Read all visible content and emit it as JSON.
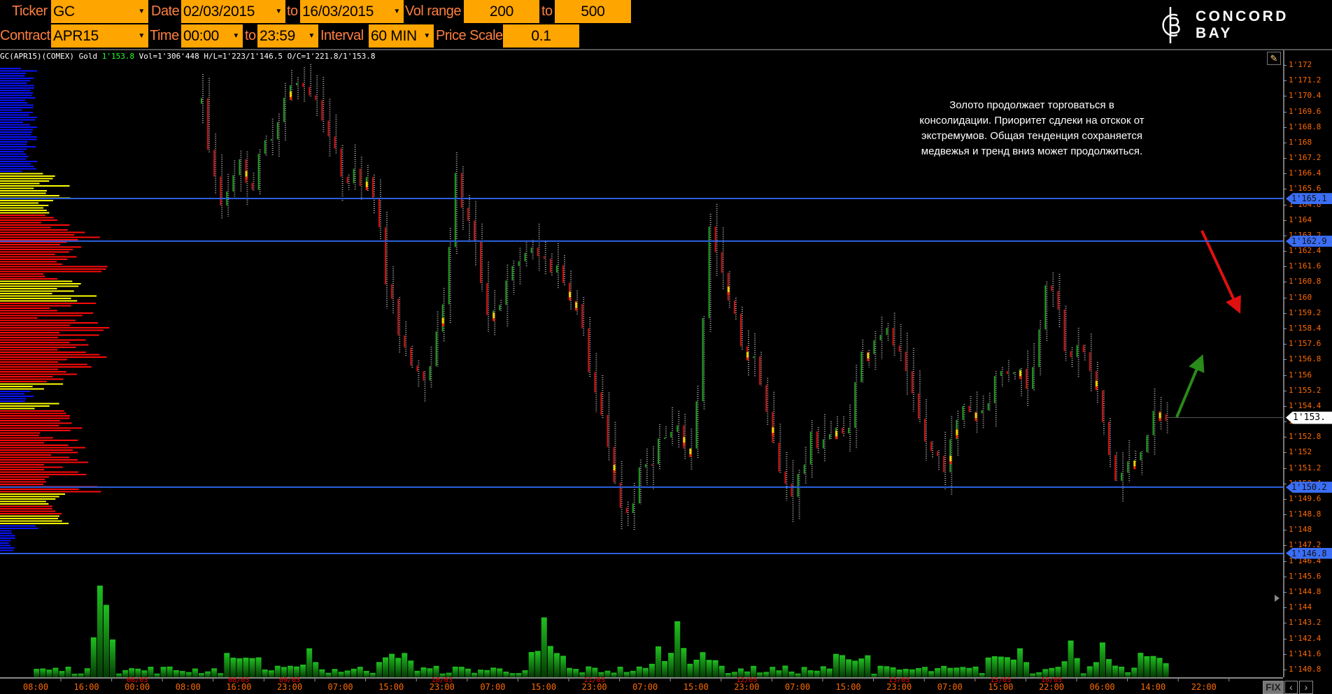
{
  "toolbar": {
    "ticker_label": "Ticker",
    "ticker_value": "GC",
    "date_label": "Date",
    "date_from": "02/03/2015",
    "date_to_label": "to",
    "date_to": "16/03/2015",
    "vol_range_label": "Vol range",
    "vol_from": "200",
    "vol_to_label": "to",
    "vol_to": "500",
    "contract_label": "Contract",
    "contract_value": "APR15",
    "time_label": "Time",
    "time_from": "00:00",
    "time_to_label": "to",
    "time_to": "23:59",
    "interval_label": "Interval",
    "interval_value": "60 MIN",
    "price_scale_label": "Price Scale",
    "price_scale_value": "0.1"
  },
  "logo": {
    "text": "CONCORD BAY"
  },
  "info": {
    "prefix": "GC(APR15)(COMEX) Gold ",
    "last": "1'153.8",
    "stats": " Vol=1'306'448 H/L=1'223/1'146.5 O/C=1'221.8/1'153.8"
  },
  "annotation": {
    "lines": [
      "Золото продолжает торговаться в",
      "консолидации. Приоритет сдлеки на отскок от",
      "экстремумов.  Общая тенденция сохраняется",
      "медвежья и тренд вниз может продолжиться."
    ]
  },
  "levels": [
    {
      "price": 1165.1,
      "label": "1'165.1"
    },
    {
      "price": 1162.9,
      "label": "1'162.9"
    },
    {
      "price": 1150.2,
      "label": "1'150.2"
    },
    {
      "price": 1146.8,
      "label": "1'146.8"
    }
  ],
  "current": {
    "price": 1153.8,
    "label": "1'153."
  },
  "colors": {
    "toolbar_bg": "#ffa500",
    "label": "#ff7f3f",
    "axis_text": "#ff6a00",
    "level": "#2b5fdc",
    "up": "#1f9e1f",
    "down": "#d01010",
    "arrow_down": "#e01010",
    "arrow_up": "#2a8a1a"
  },
  "chart_data": {
    "type": "candlestick",
    "price_range": [
      1140.4,
      1172.6
    ],
    "price_ticks": [
      "1'172",
      "1'171.2",
      "1'170.4",
      "1'169.6",
      "1'168.8",
      "1'168",
      "1'167.2",
      "1'166.4",
      "1'165.6",
      "1'164.8",
      "1'164",
      "1'163.2",
      "1'162.4",
      "1'161.6",
      "1'160.8",
      "1'160",
      "1'159.2",
      "1'158.4",
      "1'157.6",
      "1'156.8",
      "1'156",
      "1'155.2",
      "1'154.4",
      "1'153.6",
      "1'152.8",
      "1'152",
      "1'151.2",
      "1'150.4",
      "1'149.6",
      "1'148.8",
      "1'148",
      "1'147.2",
      "1'146.4",
      "1'145.6",
      "1'144.8",
      "1'144",
      "1'143.2",
      "1'142.4",
      "1'141.6",
      "1'140.8"
    ],
    "time_labels": [
      {
        "t": "08:00"
      },
      {
        "t": "16:00"
      },
      {
        "t": "00:00",
        "d": "06/03"
      },
      {
        "t": "08:00"
      },
      {
        "t": "16:00",
        "d": "08/03"
      },
      {
        "t": "23:00",
        "d": "09/03"
      },
      {
        "t": "07:00"
      },
      {
        "t": "15:00"
      },
      {
        "t": "23:00",
        "d": "10/03"
      },
      {
        "t": "07:00"
      },
      {
        "t": "15:00"
      },
      {
        "t": "23:00",
        "d": "11/03"
      },
      {
        "t": "07:00"
      },
      {
        "t": "15:00"
      },
      {
        "t": "23:00",
        "d": "12/03"
      },
      {
        "t": "07:00"
      },
      {
        "t": "15:00"
      },
      {
        "t": "23:00",
        "d": "13/03"
      },
      {
        "t": "07:00"
      },
      {
        "t": "15:00",
        "d": "15/03"
      },
      {
        "t": "22:00",
        "d": "16/03"
      },
      {
        "t": "06:00"
      },
      {
        "t": "14:00"
      },
      {
        "t": "22:00"
      }
    ],
    "close_path": [
      1170,
      1164.5,
      1167,
      1166,
      1168.5,
      1170.5,
      1171.2,
      1170,
      1166.8,
      1166.2,
      1166.5,
      1160,
      1157.5,
      1156,
      1158,
      1166,
      1163,
      1159,
      1160.5,
      1162.5,
      1162,
      1161.5,
      1160,
      1156,
      1152,
      1148.5,
      1151,
      1152.5,
      1153,
      1152,
      1163.5,
      1160,
      1157.5,
      1156,
      1151,
      1150,
      1152.5,
      1153,
      1152.8,
      1157,
      1158.5,
      1157.5,
      1154.5,
      1152,
      1151.5,
      1154.5,
      1154,
      1156,
      1156.5,
      1155.5,
      1162,
      1157,
      1157.5,
      1154.5,
      1150.5,
      1151.5,
      1153.5,
      1153.8
    ],
    "bar_count": 153,
    "volume_spikes": [
      {
        "bar": -16,
        "v": 95
      },
      {
        "bar": -15,
        "v": 75
      },
      {
        "bar": 54,
        "v": 62
      },
      {
        "bar": 75,
        "v": 58
      },
      {
        "bar": 72,
        "v": 32
      },
      {
        "bar": 129,
        "v": 30
      },
      {
        "bar": 137,
        "v": 38
      },
      {
        "bar": 142,
        "v": 36
      },
      {
        "bar": 17,
        "v": 30
      }
    ]
  }
}
